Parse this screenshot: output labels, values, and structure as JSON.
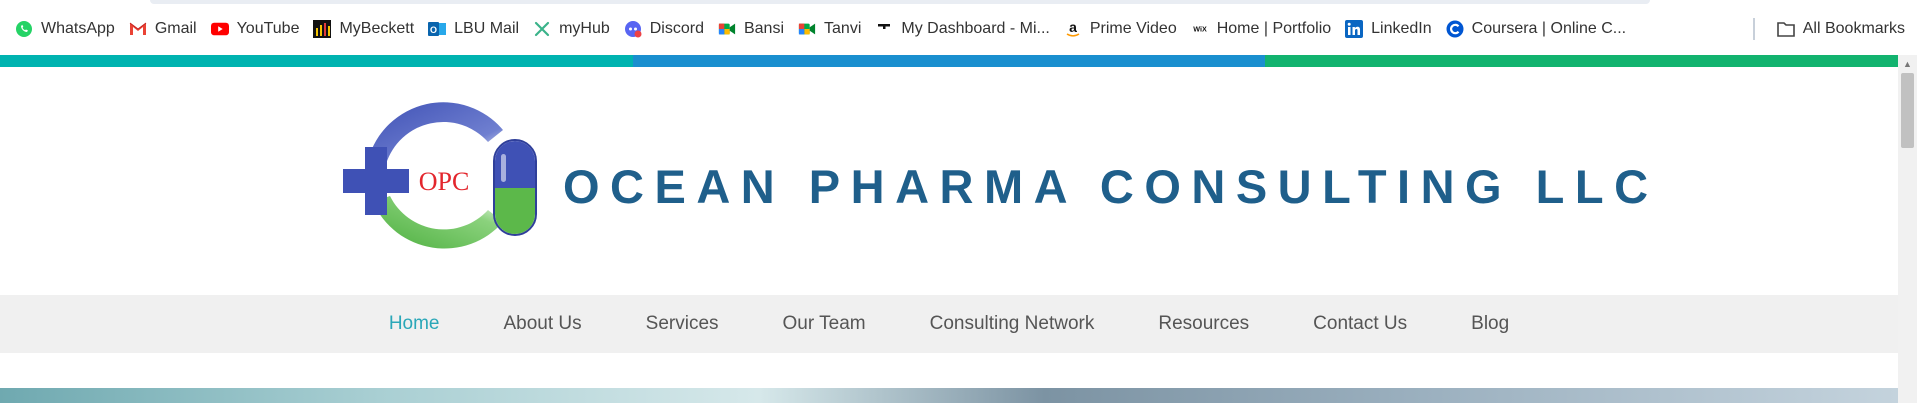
{
  "bookmarks": {
    "items": [
      {
        "label": "WhatsApp",
        "icon": "whatsapp-icon"
      },
      {
        "label": "Gmail",
        "icon": "gmail-icon"
      },
      {
        "label": "YouTube",
        "icon": "youtube-icon"
      },
      {
        "label": "MyBeckett",
        "icon": "mybeckett-icon"
      },
      {
        "label": "LBU Mail",
        "icon": "outlook-icon"
      },
      {
        "label": "myHub",
        "icon": "myhub-icon"
      },
      {
        "label": "Discord",
        "icon": "discord-icon"
      },
      {
        "label": "Bansi",
        "icon": "google-meet-icon"
      },
      {
        "label": "Tanvi",
        "icon": "google-meet-icon"
      },
      {
        "label": "My Dashboard - Mi...",
        "icon": "dashboard-icon"
      },
      {
        "label": "Prime Video",
        "icon": "amazon-icon"
      },
      {
        "label": "Home | Portfolio",
        "icon": "wix-icon"
      },
      {
        "label": "LinkedIn",
        "icon": "linkedin-icon"
      },
      {
        "label": "Coursera | Online C...",
        "icon": "coursera-icon"
      }
    ],
    "all_bookmarks": "All Bookmarks"
  },
  "site": {
    "logo_text": "OPC",
    "brand": "OCEAN PHARMA CONSULTING LLC",
    "nav": [
      {
        "label": "Home",
        "active": true
      },
      {
        "label": "About Us",
        "active": false
      },
      {
        "label": "Services",
        "active": false
      },
      {
        "label": "Our Team",
        "active": false
      },
      {
        "label": "Consulting Network",
        "active": false
      },
      {
        "label": "Resources",
        "active": false
      },
      {
        "label": "Contact Us",
        "active": false
      },
      {
        "label": "Blog",
        "active": false
      }
    ]
  },
  "colors": {
    "brand_text": "#1f5f8b",
    "nav_active": "#2aa7b8",
    "nav_default": "#555555",
    "stripe": [
      "#00b3b0",
      "#1a8fcf",
      "#12b36f"
    ],
    "logo_blue": "#3f51b5",
    "logo_green": "#5cb84a",
    "logo_red": "#e3262d"
  }
}
